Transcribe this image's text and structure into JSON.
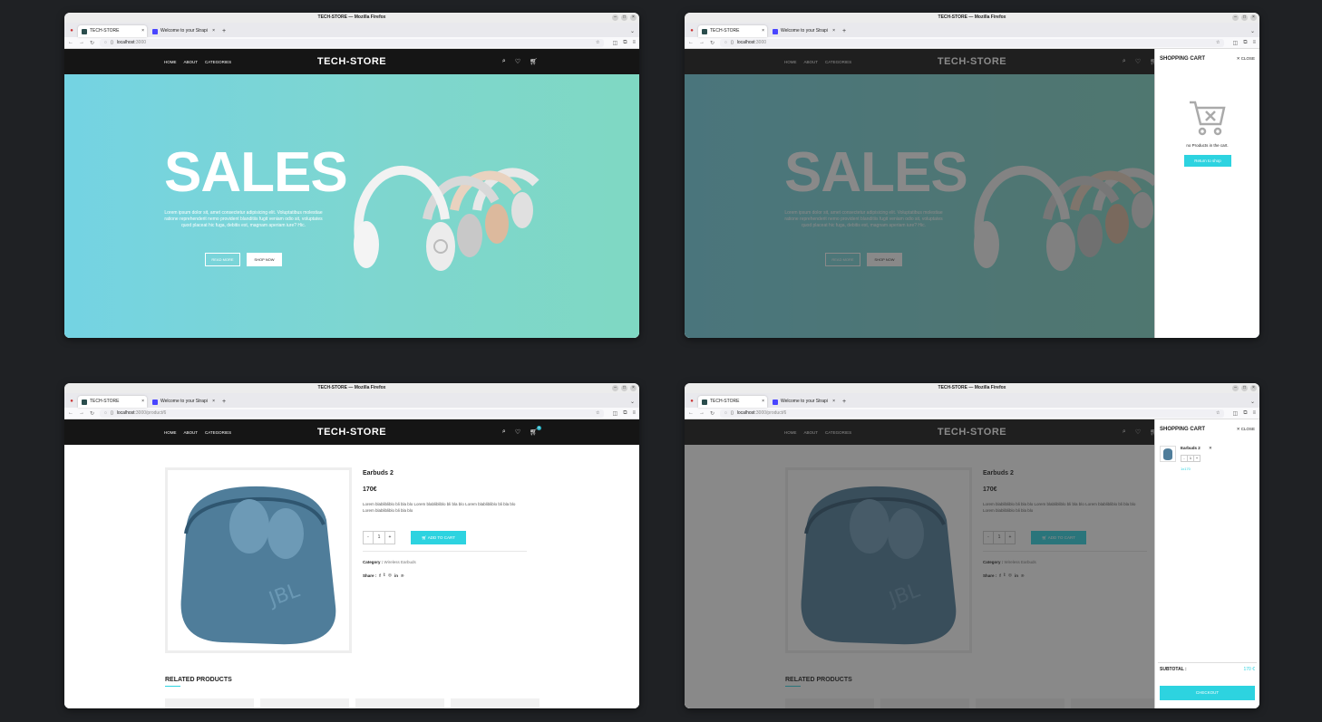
{
  "browser": {
    "window_title": "TECH-STORE — Mozilla Firefox",
    "tabs": [
      "TECH-STORE",
      "Welcome to your Strapi"
    ],
    "url_home_host": "localhost",
    "url_home_rest": ":3000",
    "url_product_host": "localhost",
    "url_product_rest": ":3000/product/6"
  },
  "site": {
    "logo": "TECH-STORE",
    "nav": [
      "HOME",
      "ABOUT",
      "CATEGORIES"
    ],
    "cart_count": "1"
  },
  "hero": {
    "headline": "SALES",
    "text": "Lorem ipsum dolor sit, amet consectetur adipisicing elit. Voluptatibus molestiae ratione reprehenderit nemo provident blanditiis fugit veniam odio sit, voluptates quod placeat hic fuga, debitis est, magnam aperiam iure? Hic.",
    "read_more": "READ MORE",
    "shop_now": "SHOP NOW"
  },
  "cart_empty": {
    "title": "SHOPPING CART",
    "close": "CLOSE",
    "message": "no Products in the cart.",
    "return": "Return to shop"
  },
  "product": {
    "title": "Earbuds 2",
    "price": "170€",
    "description": "Lorem blablibliblo bli bla blo Lorem blablibliblo bli bla blo Lorem blablibliblo bli bla blo Lorem blablibliblo bli bla blo",
    "qty": "1",
    "minus": "-",
    "plus": "+",
    "add_to_cart": "ADD TO CART",
    "category_label": "Category :",
    "category": "Wireless Earbuds",
    "share_label": "Share :",
    "related": "RELATED PRODUCTS"
  },
  "cart_full": {
    "title": "SHOPPING CART",
    "close": "CLOSE",
    "item_title": "Earbuds 2",
    "item_qty": "1",
    "item_price": "1x170",
    "subtotal_label": "SUBTOTAL :",
    "subtotal_value": "170 €",
    "checkout": "CHECKOUT"
  },
  "colors": {
    "accent": "#2dd3e0",
    "header": "#151515",
    "hero_start": "#74d3e3",
    "hero_end": "#7fd8c3"
  }
}
